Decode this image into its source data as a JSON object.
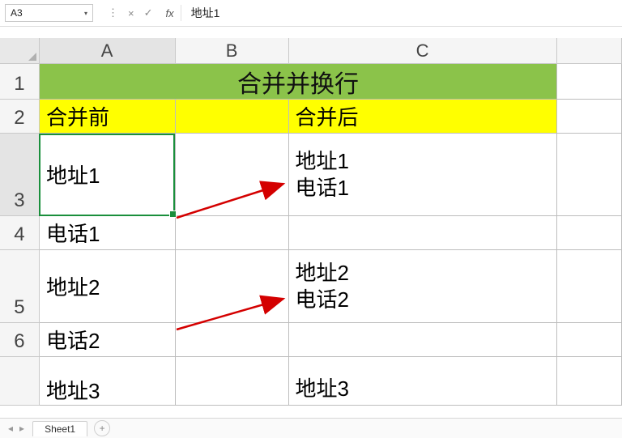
{
  "formula_bar": {
    "cell_ref": "A3",
    "fx_label": "fx",
    "content": "地址1",
    "cancel_icon": "×",
    "confirm_icon": "✓",
    "divider_icon": "⋮"
  },
  "columns": {
    "A": "A",
    "B": "B",
    "C": "C",
    "D": ""
  },
  "rows": {
    "1": "1",
    "2": "2",
    "3": "3",
    "4": "4",
    "5": "5",
    "6": "6"
  },
  "cells": {
    "title": "合并并换行",
    "A2": "合并前",
    "C2": "合并后",
    "A3": "地址1",
    "C3_line1": "地址1",
    "C3_line2": "电话1",
    "A4": "电话1",
    "A5": "地址2",
    "C5_line1": "地址2",
    "C5_line2": "电话2",
    "A6": "电话2",
    "A7": "地址3",
    "C7_line1": "地址3"
  },
  "sheet_tabs": {
    "nav_prev": "◂",
    "nav_next": "▸",
    "sheet1": "Sheet1",
    "add": "+"
  },
  "colors": {
    "title_bg": "#8bc34a",
    "header_bg": "#ffff00",
    "selection": "#1a8f3c"
  }
}
